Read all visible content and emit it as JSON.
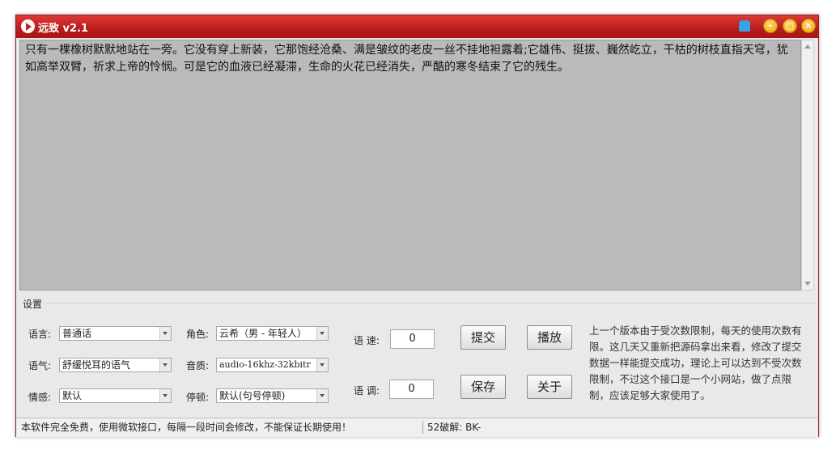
{
  "window": {
    "title": "远致 v2.1"
  },
  "text_area": {
    "content": "只有一棵橡树默默地站在一旁。它没有穿上新装，它那饱经沧桑、满是皱纹的老皮一丝不挂地袒露着;它雄伟、挺拔、巍然屹立，干枯的树枝直指天穹，犹如高举双臂，祈求上帝的怜悯。可是它的血液已经凝滞，生命的火花已经消失，严酷的寒冬结束了它的残生。"
  },
  "settings": {
    "group_label": "设置",
    "language": {
      "label": "语言:",
      "value": "普通话"
    },
    "tone": {
      "label": "语气:",
      "value": "舒缓悦耳的语气"
    },
    "emotion": {
      "label": "情感:",
      "value": "默认"
    },
    "role": {
      "label": "角色:",
      "value": "云希（男 - 年轻人）"
    },
    "quality": {
      "label": "音质:",
      "value": "audio-16khz-32kbitr"
    },
    "pause": {
      "label": "停顿:",
      "value": "默认(句号停顿)"
    },
    "speed": {
      "label": "语 速:",
      "value": "0"
    },
    "pitch": {
      "label": "语 调:",
      "value": "0"
    }
  },
  "buttons": {
    "submit": "提交",
    "play": "播放",
    "save": "保存",
    "about": "关于"
  },
  "info_text": "上一个版本由于受次数限制，每天的使用次数有限。这几天又重新把源码拿出来看，修改了提交数据一样能提交成功，理论上可以达到不受次数限制，不过这个接口是一个小网站，做了点限制，应该足够大家使用了。",
  "status": {
    "left": "本软件完全免费，使用微软接口，每隔一段时间会修改，不能保证长期使用！",
    "right": "52破解: BK-"
  },
  "colors": {
    "titlebar": "#c62020",
    "text_area_bg": "#bababa"
  }
}
